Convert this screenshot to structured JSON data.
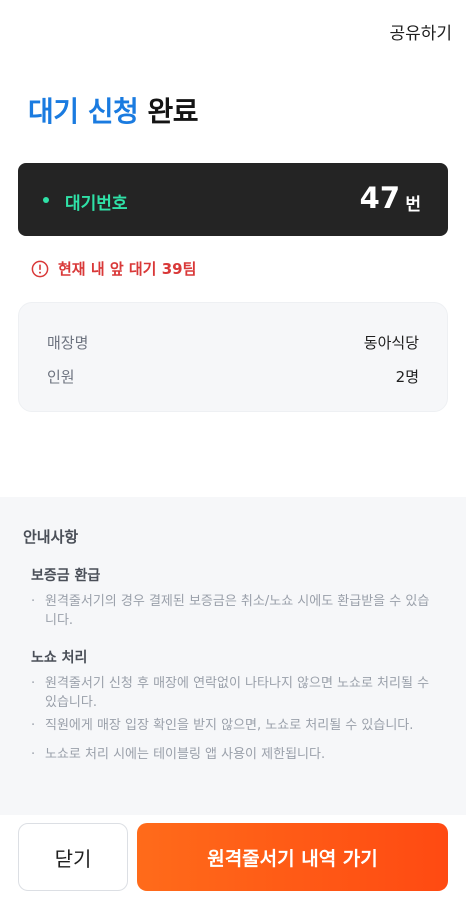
{
  "header": {
    "share_label": "공유하기"
  },
  "title": {
    "accent": "대기 신청",
    "rest": "완료"
  },
  "ticket": {
    "label": "대기번호",
    "number": "47",
    "unit": "번"
  },
  "notice": {
    "text": "현재 내 앞 대기 39팀",
    "icon": "info-circle-icon",
    "color": "#d93838"
  },
  "store": {
    "rows": [
      {
        "key": "매장명",
        "value": "동아식당"
      },
      {
        "key": "인원",
        "value": "2명"
      }
    ]
  },
  "guide": {
    "title": "안내사항",
    "sections": [
      {
        "title": "보증금 환급",
        "bullets": [
          "원격줄서기의 경우 결제된 보증금은 취소/노쇼 시에도 환급받을 수 있습니다."
        ]
      },
      {
        "title": "노쇼 처리",
        "bullets": [
          "원격줄서기 신청 후 매장에 연락없이 나타나지 않으면 노쇼로 처리될 수 있습니다.",
          "직원에게 매장 입장 확인을 받지 않으면, 노쇼로 처리될 수 있습니다.",
          "노쇼로 처리 시에는 테이블링 앱 사용이 제한됩니다."
        ]
      }
    ]
  },
  "buttons": {
    "close_label": "닫기",
    "history_label": "원격줄서기 내역 가기"
  },
  "colors": {
    "accent_blue": "#1a7be0",
    "ticket_bg": "#242424",
    "ticket_green": "#2fe1a7",
    "cta_orange": "#ff5a14"
  }
}
